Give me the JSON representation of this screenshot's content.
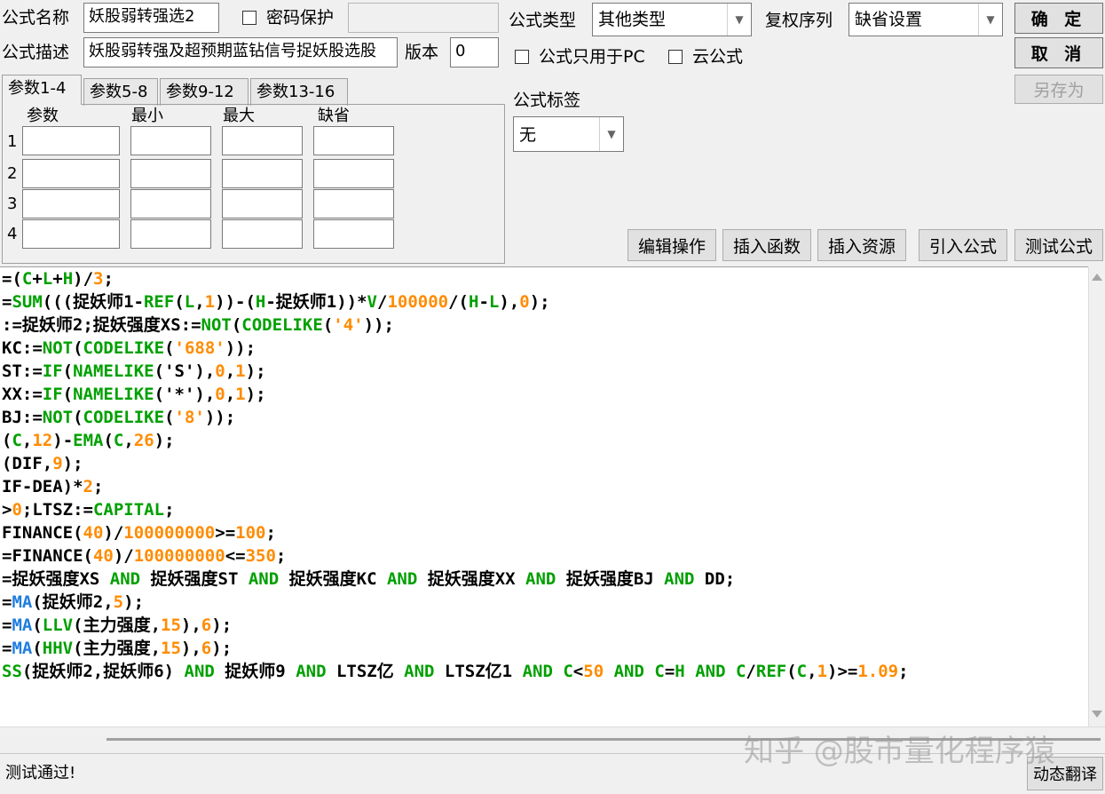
{
  "form": {
    "name_label": "公式名称",
    "name_value": "妖股弱转强选2",
    "password_label": "密码保护",
    "desc_label": "公式描述",
    "desc_value": "妖股弱转强及超预期蓝钻信号捉妖股选股",
    "version_label": "版本",
    "version_value": "0",
    "type_label": "公式类型",
    "type_value": "其他类型",
    "rights_label": "复权序列",
    "rights_value": "缺省设置",
    "pc_only_label": "公式只用于PC",
    "cloud_label": "云公式",
    "tag_label": "公式标签",
    "tag_value": "无"
  },
  "buttons": {
    "ok": "确 定",
    "cancel": "取 消",
    "save_as": "另存为",
    "edit_ops": "编辑操作",
    "insert_func": "插入函数",
    "insert_res": "插入资源",
    "import_formula": "引入公式",
    "test_formula": "测试公式",
    "dynamic_translate": "动态翻译"
  },
  "params": {
    "tabs": [
      "参数1-4",
      "参数5-8",
      "参数9-12",
      "参数13-16"
    ],
    "headers": [
      "参数",
      "最小",
      "最大",
      "缺省"
    ],
    "rows": [
      "1",
      "2",
      "3",
      "4"
    ]
  },
  "code_lines": [
    "=(C+L+H)/3;",
    "=SUM(((捉妖师1-REF(L,1))-(H-捉妖师1))*V/100000/(H-L),0);",
    ":=捉妖师2;捉妖强度XS:=NOT(CODELIKE('4'));",
    "KC:=NOT(CODELIKE('688'));",
    "ST:=IF(NAMELIKE('S'),0,1);",
    "XX:=IF(NAMELIKE('*'),0,1);",
    "BJ:=NOT(CODELIKE('8'));",
    "(C,12)-EMA(C,26);",
    "(DIF,9);",
    "IF-DEA)*2;",
    ">0;LTSZ:=CAPITAL;",
    "FINANCE(40)/100000000>=100;",
    "=FINANCE(40)/100000000<=350;",
    "=捉妖强度XS AND 捉妖强度ST AND 捉妖强度KC AND 捉妖强度XX AND 捉妖强度BJ AND DD;",
    "=MA(捉妖师2,5);",
    "=MA(LLV(主力强度,15),6);",
    "=MA(HHV(主力强度,15),6);",
    "SS(捉妖师2,捉妖师6) AND 捉妖师9 AND LTSZ亿 AND LTSZ亿1 AND C<50 AND C=H AND C/REF(C,1)>=1.09;"
  ],
  "status_text": "测试通过!",
  "watermark": "知乎 @股市量化程序猿",
  "colors": {
    "keyword": "#00a000",
    "number": "#ff8c00",
    "func_ma": "#1e7de0"
  }
}
